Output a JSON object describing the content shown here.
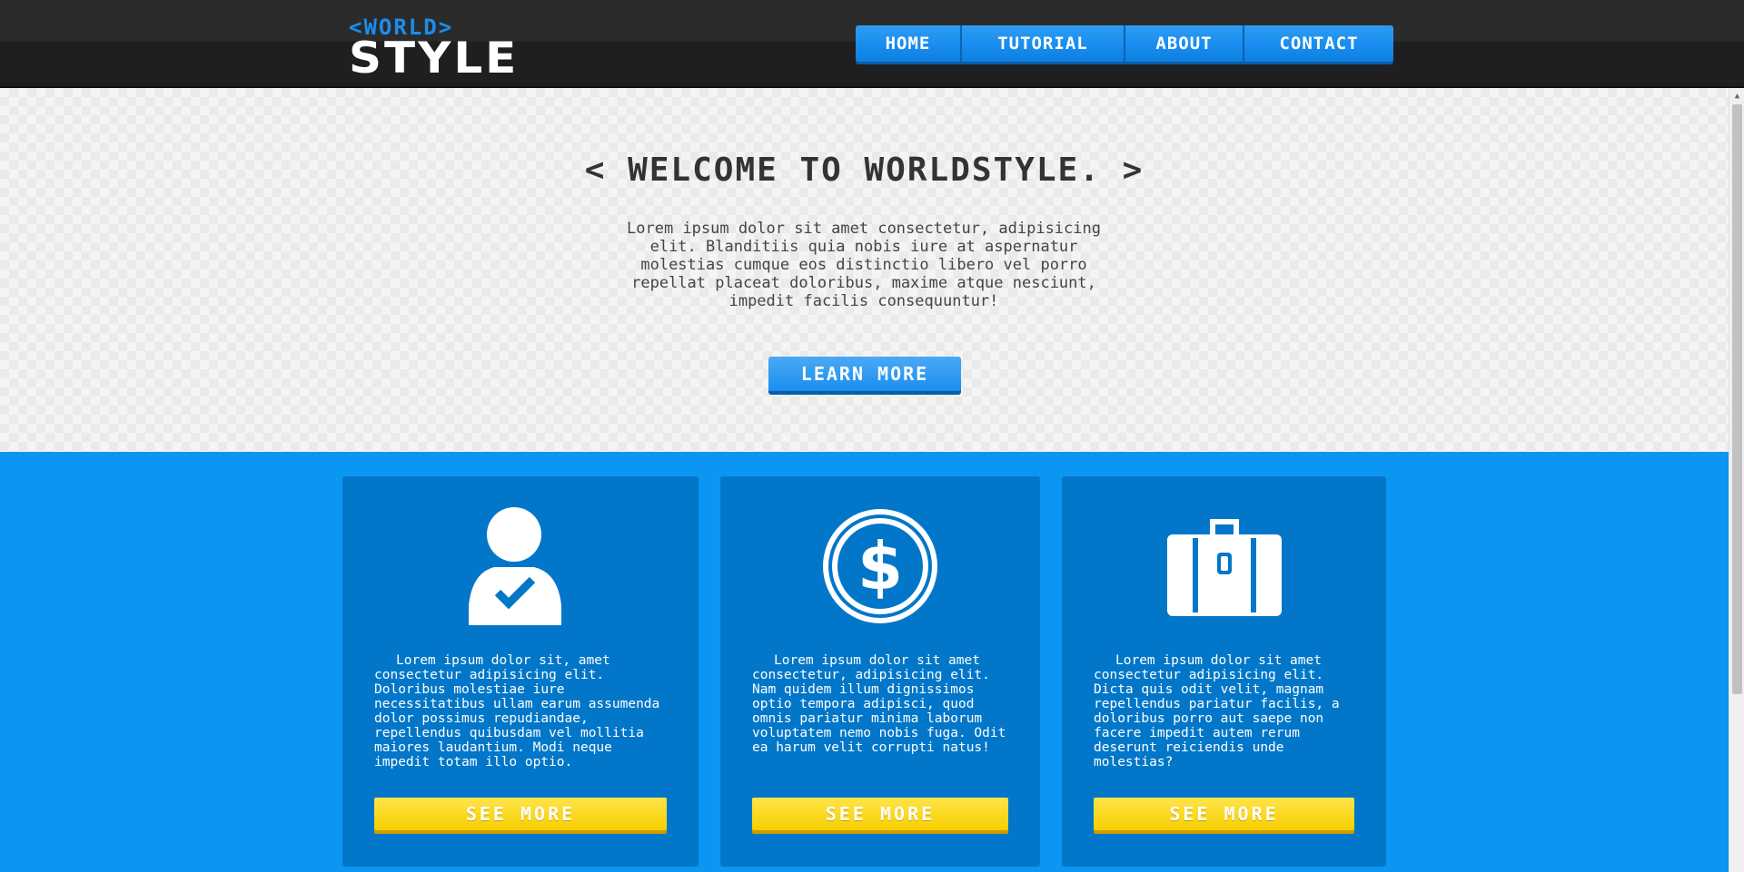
{
  "header": {
    "logo_top": "<WORLD>",
    "logo_main": "STYLE",
    "nav": [
      "HOME",
      "TUTORIAL",
      "ABOUT",
      "CONTACT"
    ]
  },
  "hero": {
    "title": "< WELCOME TO WORLDSTYLE. >",
    "text": "Lorem ipsum dolor sit amet consectetur, adipisicing elit. Blanditiis quia nobis iure at aspernatur molestias cumque eos distinctio libero vel porro repellat placeat doloribus, maxime atque nesciunt, impedit facilis consequuntur!",
    "button": "LEARN MORE"
  },
  "cards": [
    {
      "icon": "user-check-icon",
      "text": "Lorem ipsum dolor sit, amet consectetur adipisicing elit. Doloribus molestiae iure necessitatibus ullam earum assumenda dolor possimus repudiandae, repellendus quibusdam vel mollitia maiores laudantium. Modi neque impedit totam illo optio.",
      "button": "SEE MORE"
    },
    {
      "icon": "dollar-coin-icon",
      "text": "Lorem ipsum dolor sit amet consectetur, adipisicing elit. Nam quidem illum dignissimos optio tempora adipisci, quod omnis pariatur minima laborum voluptatem nemo nobis fuga. Odit ea harum velit corrupti natus!",
      "button": "SEE MORE"
    },
    {
      "icon": "briefcase-icon",
      "text": "Lorem ipsum dolor sit amet consectetur adipisicing elit. Dicta quis odit velit, magnam repellendus pariatur facilis, a doloribus porro aut saepe non facere impedit autem rerum deserunt reiciendis unde molestias?",
      "button": "SEE MORE"
    }
  ],
  "colors": {
    "header_bg": "#222222",
    "accent_blue": "#1a8ef0",
    "band_blue": "#0a96f2",
    "card_blue": "#0277c9",
    "button_yellow": "#f7cf00"
  }
}
